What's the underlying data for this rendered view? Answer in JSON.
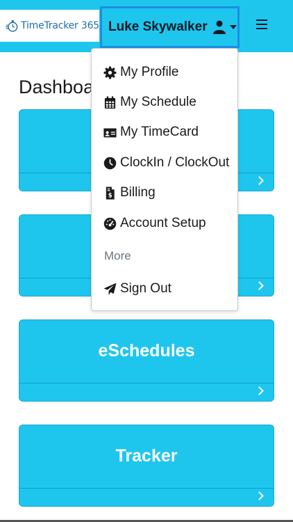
{
  "header": {
    "brand": "TimeTracker 365",
    "user_name": "Luke Skywalker"
  },
  "page": {
    "title": "Dashboard"
  },
  "cards": [
    {
      "title": ""
    },
    {
      "title": ""
    },
    {
      "title": "eSchedules"
    },
    {
      "title": "Tracker"
    }
  ],
  "user_menu": {
    "items": [
      {
        "label": "My Profile",
        "icon": "gear-icon"
      },
      {
        "label": "My Schedule",
        "icon": "calendar-icon"
      },
      {
        "label": "My TimeCard",
        "icon": "id-card-icon"
      },
      {
        "label": "ClockIn / ClockOut",
        "icon": "clock-icon"
      },
      {
        "label": "Billing",
        "icon": "invoice-icon"
      },
      {
        "label": "Account Setup",
        "icon": "tachometer-icon"
      }
    ],
    "section_header": "More",
    "sign_out": {
      "label": "Sign Out",
      "icon": "paper-plane-icon"
    }
  },
  "colors": {
    "accent": "#1ec6ee",
    "accent_border": "#1a8fe3",
    "brand_text": "#1e6fa8"
  }
}
